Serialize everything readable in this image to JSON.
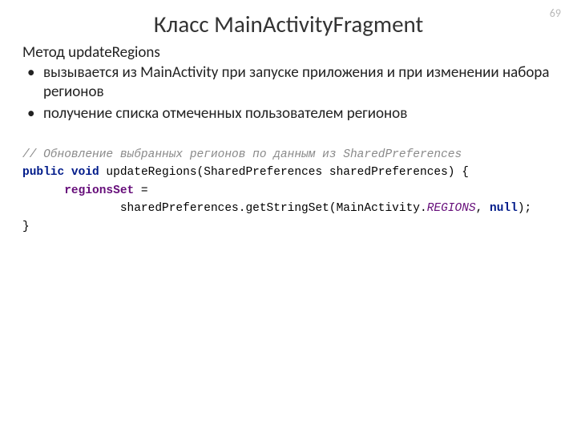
{
  "pageNumber": "69",
  "title": "Класс MainActivityFragment",
  "subtitle": "Метод updateRegions",
  "bullets": [
    "вызывается из MainActivity при запуске приложения и при изменении набора регионов",
    "получение списка отмеченных пользователем регионов"
  ],
  "code": {
    "comment": "// Обновление выбранных регионов по данным из SharedPreferences",
    "kw_public": "public",
    "kw_void": "void",
    "fn": " updateRegions(SharedPreferences sharedPreferences) {",
    "indent1": "      ",
    "field": "regionsSet",
    "assign": " =",
    "indent2": "              sharedPreferences.getStringSet(MainActivity.",
    "staticField": "REGIONS",
    "tail": ", ",
    "kw_null": "null",
    "close": ");",
    "brace": "}"
  }
}
